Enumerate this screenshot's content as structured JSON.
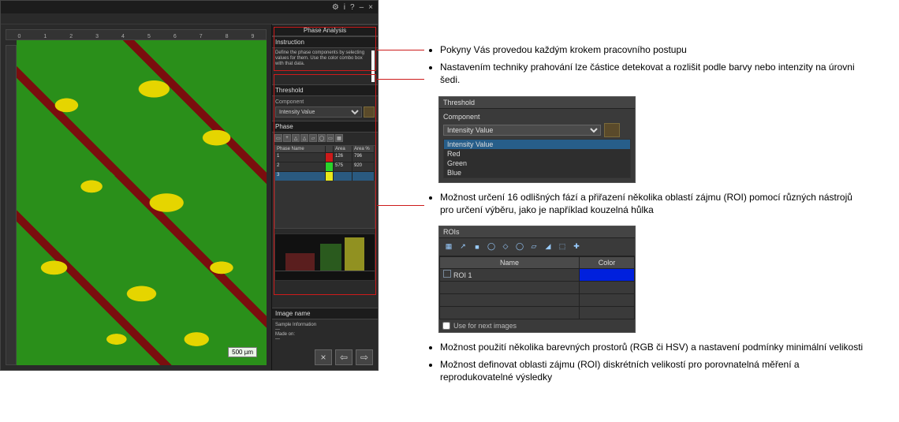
{
  "app": {
    "title": "Phase Analysis",
    "topbar_icons": [
      "gear-icon",
      "info-icon",
      "help-icon",
      "minimize-icon",
      "close-icon"
    ],
    "topbar_labels": [
      "⚙",
      "i",
      "?",
      "–",
      "×"
    ],
    "scalebar": "500 µm",
    "ruler_ticks": [
      "0",
      "1",
      "2",
      "3",
      "4",
      "5",
      "6",
      "7",
      "8",
      "9"
    ],
    "side": {
      "instruction_hdr": "Instruction",
      "instruction_text": "Define the phase components by selecting values for them. Use the color combo box with that data.",
      "threshold_hdr": "Threshold",
      "threshold_label": "Component",
      "threshold_value": "Intensity Value",
      "phase_hdr": "Phase",
      "table": {
        "headers": [
          "Phase Name",
          "",
          "Area",
          "Area %"
        ],
        "rows": [
          {
            "name": "1",
            "swatch": "#cc1a1a",
            "area": "126",
            "pct": "796"
          },
          {
            "name": "2",
            "swatch": "#2ad22a",
            "area": "575",
            "pct": "920"
          },
          {
            "name": "3",
            "swatch": "#e9e91a",
            "area": "—",
            "pct": "—"
          }
        ]
      },
      "info_hdr": "Image name",
      "info_lines": [
        "Sample Information",
        "—",
        "Made on:",
        "—"
      ],
      "nav": [
        "×",
        "⇦",
        "⇨"
      ]
    }
  },
  "rhs": {
    "bullets": [
      "Pokyny Vás provedou každým krokem pracovního postupu",
      "Nastavením techniky prahování lze částice detekovat a rozlišit podle barvy nebo intenzity na úrovni šedi.",
      "Možnost určení 16 odlišných fází a přiřazení několika oblastí zájmu (ROI) pomocí různých nástrojů pro určení výběru, jako je například kouzelná hůlka",
      "Možnost použití několika barevných prostorů (RGB či HSV) a nastavení podmínky minimální velikosti",
      "Možnost definovat oblasti zájmu (ROI) diskrétních velikostí pro porovnatelná měření a reprodukovatelné výsledky"
    ],
    "threshold_detail": {
      "title": "Threshold",
      "label": "Component",
      "selected": "Intensity Value",
      "options": [
        "Intensity Value",
        "Red",
        "Green",
        "Blue"
      ]
    },
    "rois_detail": {
      "title": "ROIs",
      "icons": [
        "▦",
        "↗",
        "■",
        "◯",
        "◇",
        "◯",
        "▱",
        "◢",
        "⬚",
        "✚"
      ],
      "columns": [
        "Name",
        "Color"
      ],
      "rows": [
        {
          "name": "ROI 1",
          "color": "#0020dd"
        }
      ],
      "checkbox_label": "Use for next images"
    }
  }
}
